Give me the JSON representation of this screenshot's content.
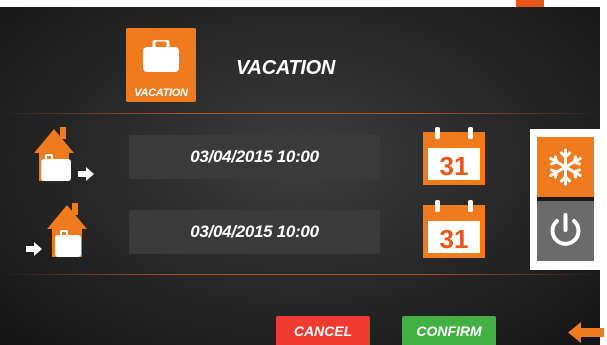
{
  "header": {
    "title": "VACATION",
    "logo_caption": "VACATION"
  },
  "schedule": {
    "departure": {
      "datetime": "03/04/2015 10:00",
      "calendar_day": "31"
    },
    "return": {
      "datetime": "03/04/2015 10:00",
      "calendar_day": "31"
    }
  },
  "mode_panel": {
    "options": [
      "snowflake-icon",
      "power-icon"
    ],
    "selected": "snowflake-icon"
  },
  "actions": {
    "cancel_label": "CANCEL",
    "confirm_label": "CONFIRM"
  },
  "colors": {
    "accent": "#f07a1e",
    "cancel": "#ef3a32",
    "confirm": "#43b044",
    "background": "#2a2a2a"
  }
}
